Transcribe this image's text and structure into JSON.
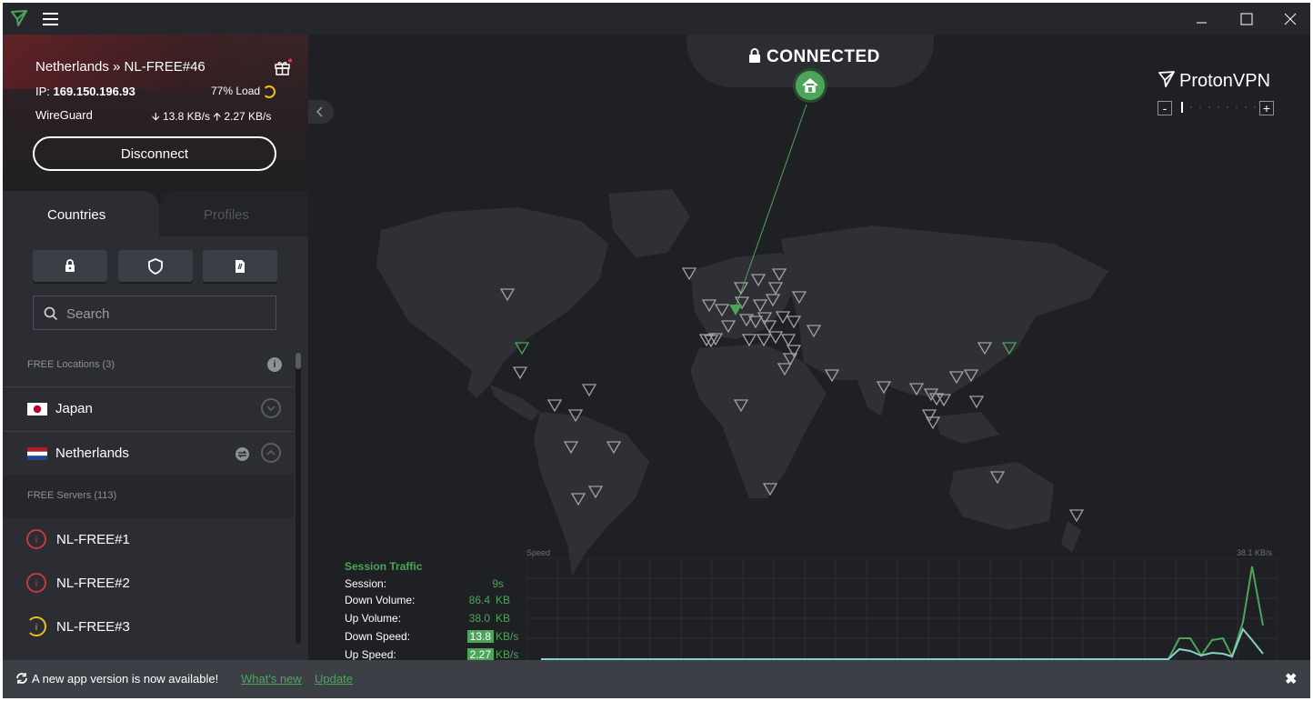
{
  "titlebar": {
    "minimize": "—",
    "maximize": "☐",
    "close": "✕"
  },
  "connection": {
    "server": "Netherlands » NL-FREE#46",
    "ip_label": "IP:",
    "ip": "169.150.196.93",
    "load": "77% Load",
    "protocol": "WireGuard",
    "down_speed": "13.8 KB/s",
    "up_speed": "2.27 KB/s",
    "disconnect_label": "Disconnect"
  },
  "tabs": {
    "countries": "Countries",
    "profiles": "Profiles"
  },
  "search": {
    "placeholder": "Search"
  },
  "free_locations": {
    "header": "FREE Locations (3)"
  },
  "countries": [
    {
      "name": "Japan",
      "expanded": false
    },
    {
      "name": "Netherlands",
      "expanded": true
    }
  ],
  "free_servers": {
    "header": "FREE Servers (113)"
  },
  "servers": [
    {
      "name": "NL-FREE#1",
      "status": "maintenance",
      "color": "#c33b3b"
    },
    {
      "name": "NL-FREE#2",
      "status": "maintenance",
      "color": "#c33b3b"
    },
    {
      "name": "NL-FREE#3",
      "status": "medium-load",
      "color": "#e8c21b"
    }
  ],
  "map": {
    "status": "CONNECTED",
    "brand": "ProtonVPN",
    "zoom_out": "-",
    "zoom_in": "+"
  },
  "traffic": {
    "title": "Session Traffic",
    "rows": [
      {
        "label": "Session:",
        "value": "9s",
        "unit": ""
      },
      {
        "label": "Down Volume:",
        "value": "86.4",
        "unit": "KB"
      },
      {
        "label": "Up Volume:",
        "value": "38.0",
        "unit": "KB"
      },
      {
        "label": "Down Speed:",
        "value": "13.8",
        "unit": "KB/s"
      },
      {
        "label": "Up Speed:",
        "value": "2.27",
        "unit": "KB/s"
      }
    ],
    "speed_label": "Speed",
    "speed_max": "38.1  KB/s"
  },
  "notice": {
    "text": "A new app version is now available!",
    "whats_new": "What's new",
    "update": "Update",
    "close": "✖"
  },
  "colors": {
    "accent": "#4ca55b",
    "background": "#25272c",
    "sidebar": "#2b2d33",
    "warning": "#e8c21b",
    "error": "#c33b3b"
  }
}
